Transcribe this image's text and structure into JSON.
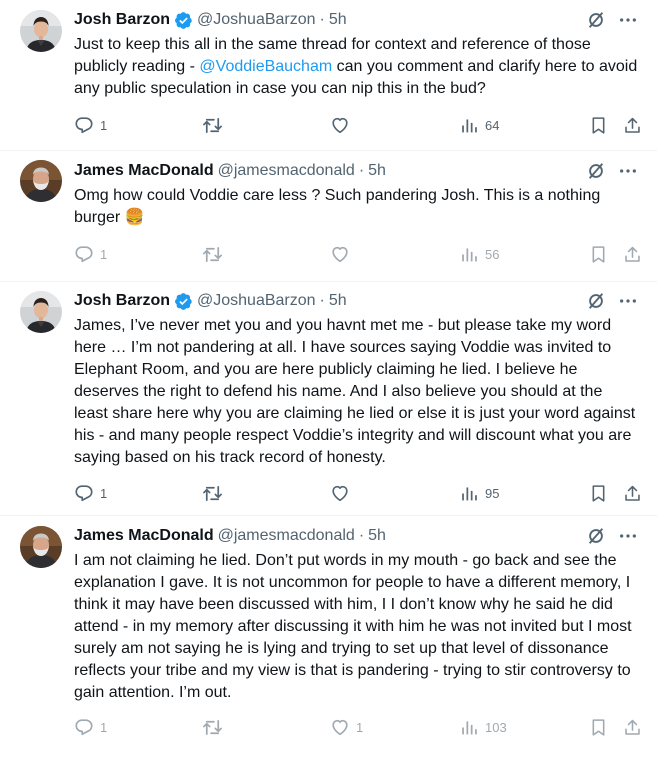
{
  "tweets": [
    {
      "name": "Josh Barzon",
      "verified": true,
      "handle": "@JoshuaBarzon",
      "dot": "·",
      "time": "5h",
      "text_before": "Just to keep this all in the same thread for context and reference of those publicly reading - ",
      "mention": "@VoddieBaucham",
      "text_after": " can you comment and clarify here to avoid any public speculation in case you can nip this in the bud?",
      "replies": "1",
      "views": "64"
    },
    {
      "name": "James MacDonald",
      "verified": false,
      "handle": "@jamesmacdonald",
      "dot": "·",
      "time": "5h",
      "text": "Omg how could Voddie care less ? Such pandering Josh.  This is a nothing burger 🍔",
      "replies": "1",
      "views": "56"
    },
    {
      "name": "Josh Barzon",
      "verified": true,
      "handle": "@JoshuaBarzon",
      "dot": "·",
      "time": "5h",
      "text": "James, I’ve never met you and you havnt met me - but please take my word here … I’m not pandering at all. I have sources saying Voddie was invited to Elephant Room, and you are here publicly claiming he lied. I believe he deserves the right to defend his name. And I also believe you should at the least share here why you are claiming he lied or else it is just your word against his - and many people respect Voddie’s integrity and will discount what you are saying based on his track record of honesty.",
      "replies": "1",
      "views": "95"
    },
    {
      "name": "James MacDonald",
      "verified": false,
      "handle": "@jamesmacdonald",
      "dot": "·",
      "time": "5h",
      "text": "I am not claiming he lied. Don’t put words in my mouth - go back and see the explanation I gave.  It is not uncommon for people to have a different memory, I think it may have been discussed with him, I I don’t know why he said he did attend - in my memory after discussing it with him he was not invited but I most surely am not saying he is lying and trying to set up that level of dissonance reflects your tribe and my view is that is pandering - trying to stir controversy to gain attention.  I’m out.",
      "replies": "1",
      "likes": "1",
      "views": "103"
    }
  ],
  "colors": {
    "text": "#0f1419",
    "secondary": "#536471",
    "link": "#1d9bf0",
    "verified": "#1d9bf0",
    "divider": "#eff3f4"
  },
  "icons": [
    "verified-badge-icon",
    "grok-icon",
    "more-icon",
    "reply-icon",
    "retweet-icon",
    "like-icon",
    "views-icon",
    "bookmark-icon",
    "share-icon"
  ]
}
